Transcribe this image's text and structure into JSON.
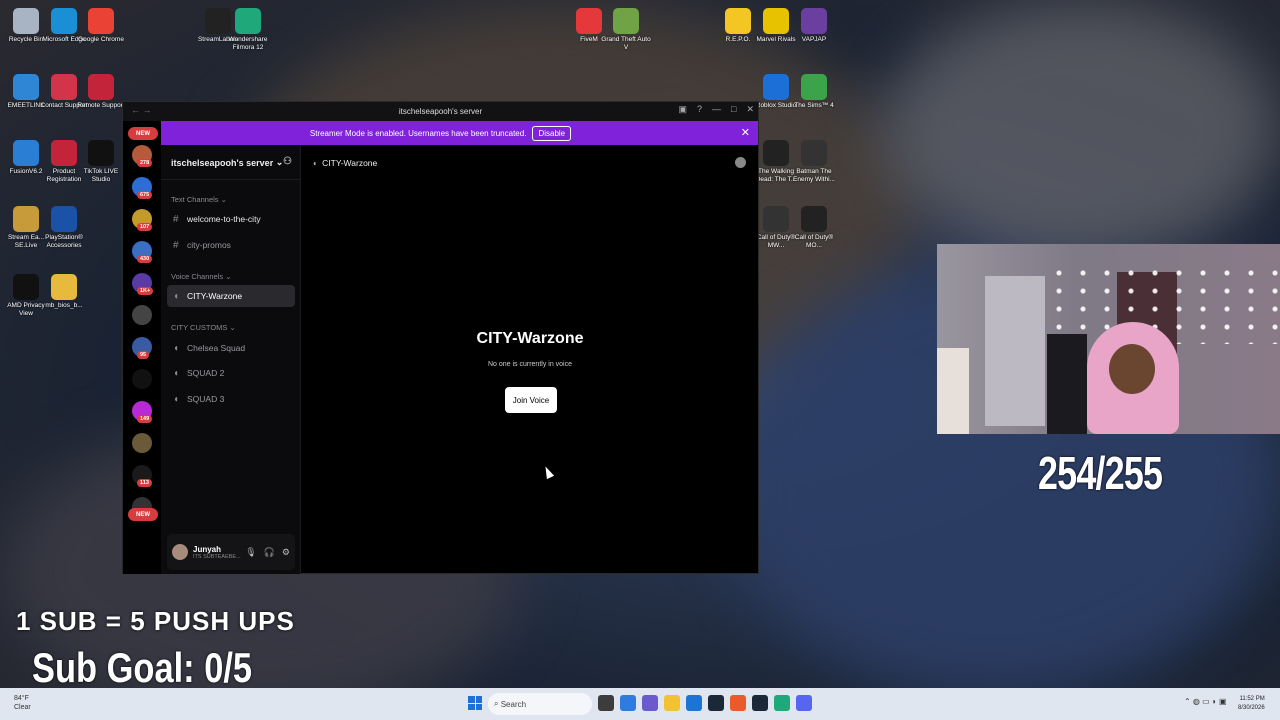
{
  "desktop_icons": [
    {
      "label": "Recycle Bin",
      "color": "#a8b4c4"
    },
    {
      "label": "Microsoft Edge",
      "color": "#1b8fd6"
    },
    {
      "label": "Google Chrome",
      "color": "#ea4335"
    },
    {
      "label": "StreamLabels",
      "color": "#222222"
    },
    {
      "label": "Wondershare Filmora 12",
      "color": "#1fa87a"
    },
    {
      "label": "FiveM",
      "color": "#e5383b"
    },
    {
      "label": "Grand Theft Auto V",
      "color": "#6fa345"
    },
    {
      "label": "R.E.P.O.",
      "color": "#f3c623"
    },
    {
      "label": "Marvel Rivals",
      "color": "#e6c200"
    },
    {
      "label": "VAPJAP",
      "color": "#6b3fa0"
    },
    {
      "label": "EMEETLINK",
      "color": "#2f86d4"
    },
    {
      "label": "Contact Support",
      "color": "#d3344a"
    },
    {
      "label": "Remote Support",
      "color": "#c4243a"
    },
    {
      "label": "Roblox Studio",
      "color": "#1b6fd6"
    },
    {
      "label": "The Sims™ 4",
      "color": "#3ba34a"
    },
    {
      "label": "FusionV6.2",
      "color": "#2a7fd4"
    },
    {
      "label": "Product Registration",
      "color": "#c4243a"
    },
    {
      "label": "TikTok LIVE Studio",
      "color": "#111111"
    },
    {
      "label": "The Walking Dead: The T...",
      "color": "#222222"
    },
    {
      "label": "Batman The Enemy Withi...",
      "color": "#333333"
    },
    {
      "label": "Stream Ea... SE.Live",
      "color": "#c79a3a"
    },
    {
      "label": "PlayStation® Accessories",
      "color": "#1a52a8"
    },
    {
      "label": "Call of Duty® MW...",
      "color": "#333333"
    },
    {
      "label": "Call of Duty® MO...",
      "color": "#222222"
    },
    {
      "label": "AMD Privacy View",
      "color": "#111111"
    },
    {
      "label": "mb_bios_b...",
      "color": "#e7b93c"
    }
  ],
  "discord": {
    "window_title": "itschelseapooh's server",
    "banner_text": "Streamer Mode is enabled. Usernames have been truncated.",
    "banner_button": "Disable",
    "server_name": "itschelseapooh's server",
    "categories": {
      "text": "Text Channels",
      "voice": "Voice Channels",
      "customs": "CITY CUSTOMS"
    },
    "channels": {
      "welcome": "welcome-to-the-city",
      "promos": "city-promos",
      "warzone": "CITY-Warzone",
      "chelsea": "Chelsea Squad",
      "squad2": "SQUAD 2",
      "squad3": "SQUAD 3"
    },
    "guild_badges": [
      "278",
      "675",
      "107",
      "430",
      "1K+",
      "95",
      "149",
      "113"
    ],
    "new_label": "NEW",
    "user": {
      "name": "Junyah",
      "status": "ITS SUBTEAEBE..."
    },
    "header_channel": "CITY-Warzone",
    "voice_title": "CITY-Warzone",
    "voice_subtitle": "No one is currently in voice",
    "join_button": "Join Voice"
  },
  "overlay": {
    "goal_count": "254/255",
    "pushups": "1 SUB = 5 PUSH UPS",
    "sub_goal": "Sub Goal: 0/5"
  },
  "taskbar": {
    "weather_temp": "84°F",
    "weather_cond": "Clear",
    "search_placeholder": "Search",
    "time": "11:52 PM",
    "date": "8/30/2026"
  }
}
